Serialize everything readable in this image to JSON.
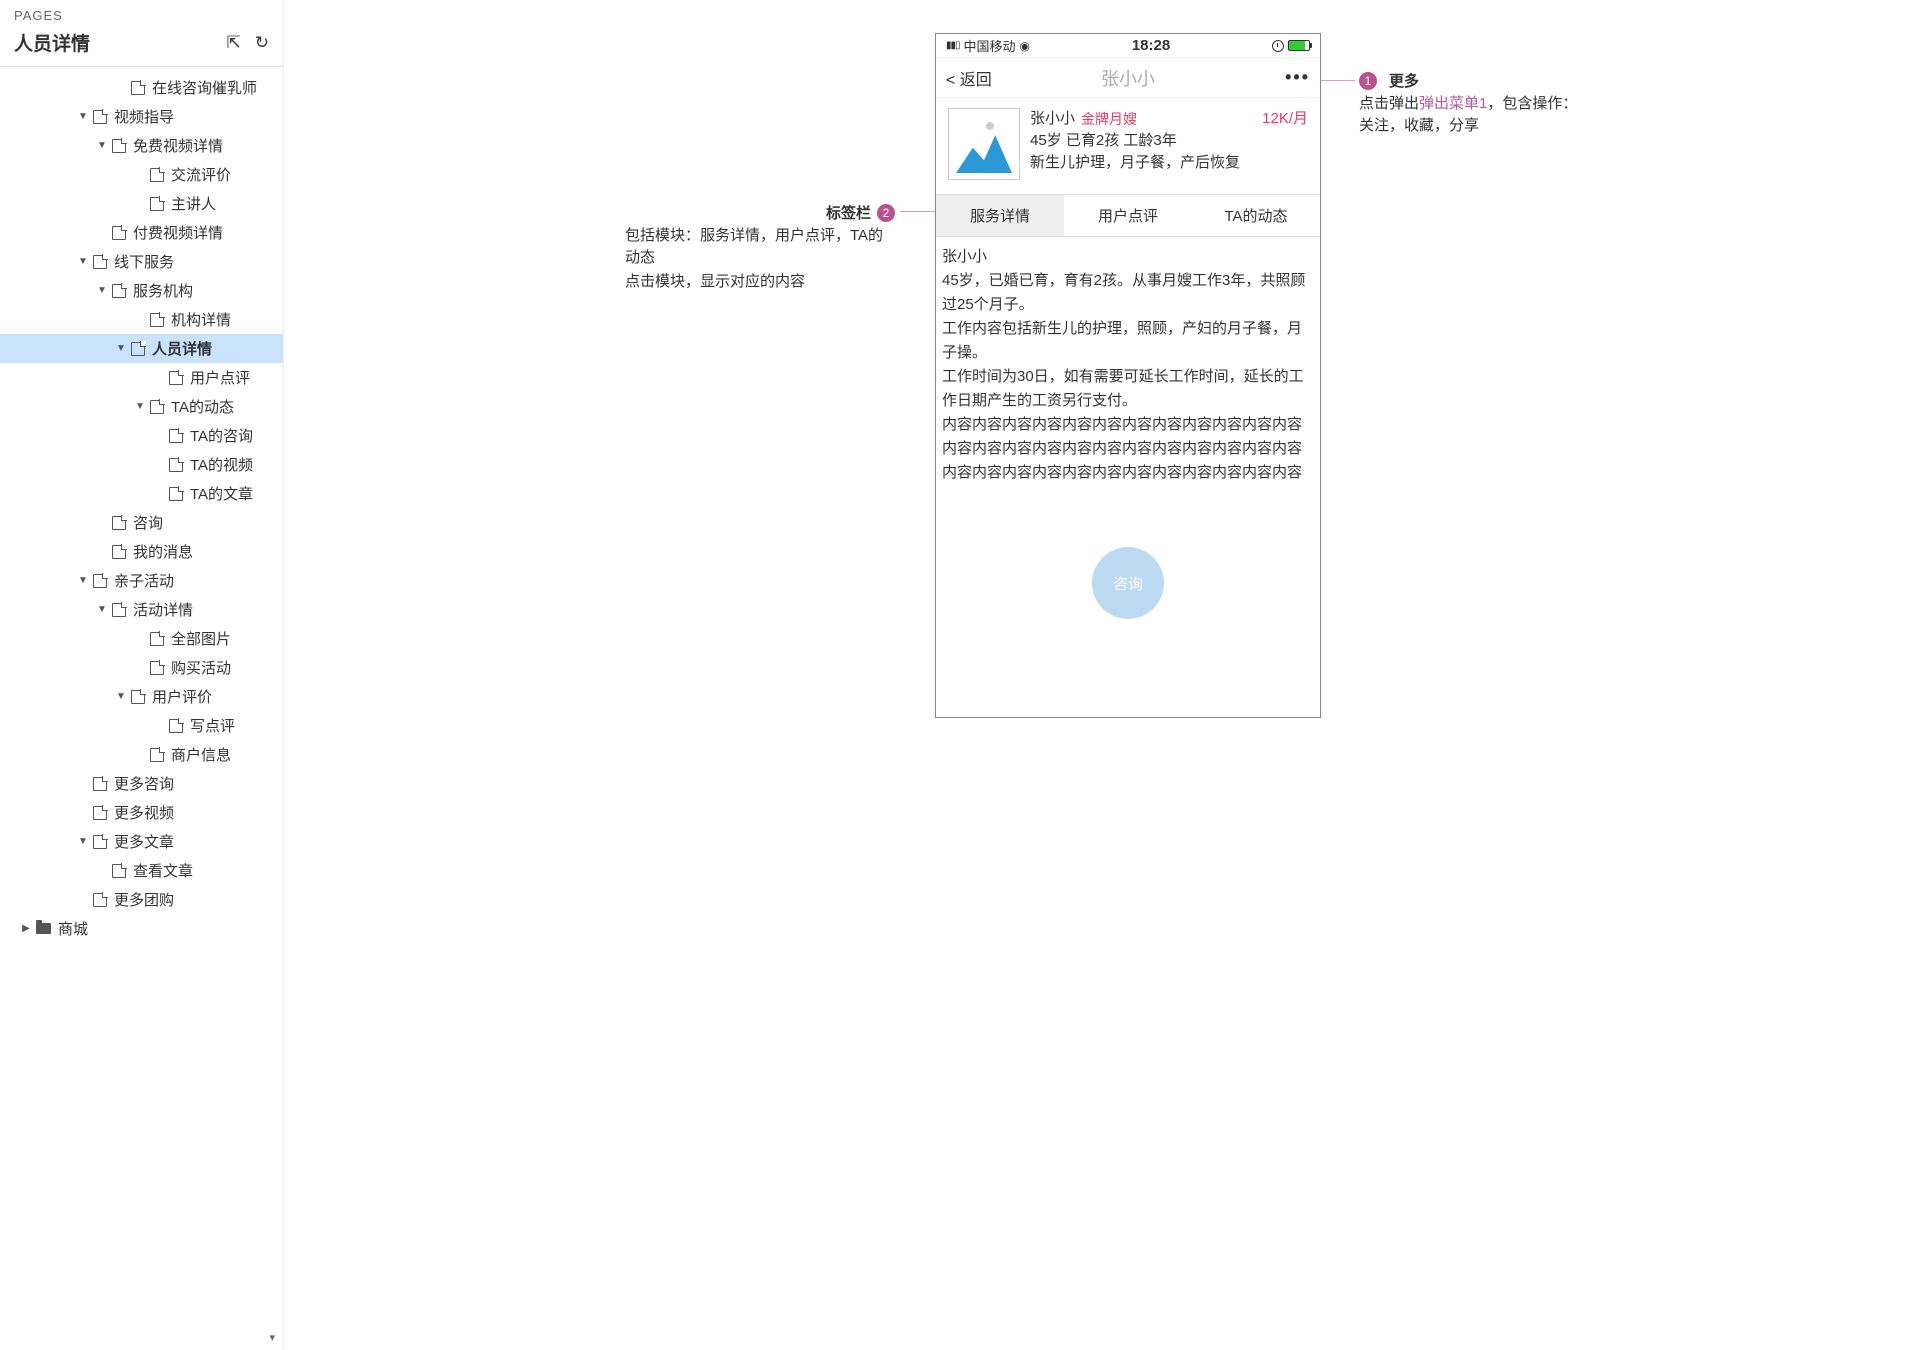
{
  "sidebar": {
    "section_label": "PAGES",
    "title": "人员详情",
    "items": [
      {
        "label": "在线咨询催乳师",
        "indent": 6,
        "caret": null
      },
      {
        "label": "视频指导",
        "indent": 4,
        "caret": "down"
      },
      {
        "label": "免费视频详情",
        "indent": 5,
        "caret": "down"
      },
      {
        "label": "交流评价",
        "indent": 7,
        "caret": null
      },
      {
        "label": "主讲人",
        "indent": 7,
        "caret": null
      },
      {
        "label": "付费视频详情",
        "indent": 5,
        "caret": null
      },
      {
        "label": "线下服务",
        "indent": 4,
        "caret": "down"
      },
      {
        "label": "服务机构",
        "indent": 5,
        "caret": "down"
      },
      {
        "label": "机构详情",
        "indent": 7,
        "caret": null
      },
      {
        "label": "人员详情",
        "indent": 6,
        "caret": "down",
        "active": true
      },
      {
        "label": "用户点评",
        "indent": 8,
        "caret": null
      },
      {
        "label": "TA的动态",
        "indent": 7,
        "caret": "down"
      },
      {
        "label": "TA的咨询",
        "indent": 8,
        "caret": null
      },
      {
        "label": "TA的视频",
        "indent": 8,
        "caret": null
      },
      {
        "label": "TA的文章",
        "indent": 8,
        "caret": null
      },
      {
        "label": "咨询",
        "indent": 5,
        "caret": null
      },
      {
        "label": "我的消息",
        "indent": 5,
        "caret": null
      },
      {
        "label": "亲子活动",
        "indent": 4,
        "caret": "down"
      },
      {
        "label": "活动详情",
        "indent": 5,
        "caret": "down"
      },
      {
        "label": "全部图片",
        "indent": 7,
        "caret": null
      },
      {
        "label": "购买活动",
        "indent": 7,
        "caret": null
      },
      {
        "label": "用户评价",
        "indent": 6,
        "caret": "down"
      },
      {
        "label": "写点评",
        "indent": 8,
        "caret": null
      },
      {
        "label": "商户信息",
        "indent": 7,
        "caret": null
      },
      {
        "label": "更多咨询",
        "indent": 4,
        "caret": null
      },
      {
        "label": "更多视频",
        "indent": 4,
        "caret": null
      },
      {
        "label": "更多文章",
        "indent": 4,
        "caret": "down"
      },
      {
        "label": "查看文章",
        "indent": 5,
        "caret": null
      },
      {
        "label": "更多团购",
        "indent": 4,
        "caret": null
      },
      {
        "label": "商城",
        "indent": 1,
        "caret": "right",
        "folder": true
      }
    ]
  },
  "mockup": {
    "status": {
      "carrier": "中国移动",
      "time": "18:28"
    },
    "nav": {
      "back": "返回",
      "title": "张小小",
      "more": "•••"
    },
    "profile": {
      "name": "张小小",
      "badge": "金牌月嫂",
      "price": "12K/月",
      "line2": "45岁  已育2孩   工龄3年",
      "line3": "新生儿护理，月子餐，产后恢复"
    },
    "tabs": [
      "服务详情",
      "用户点评",
      "TA的动态"
    ],
    "body_lines": [
      "张小小",
      "45岁，已婚已育，育有2孩。从事月嫂工作3年，共照顾过25个月子。",
      "工作内容包括新生儿的护理，照顾，产妇的月子餐，月子操。",
      "工作时间为30日，如有需要可延长工作时间，延长的工作日期产生的工资另行支付。",
      "内容内容内容内容内容内容内容内容内容内容内容内容内容内容内容内容内容内容内容内容内容内容内容内容内容内容内容内容内容内容内容内容内容内容内容内容"
    ],
    "consult": "咨询"
  },
  "annotations": {
    "a1": {
      "num": "1",
      "title": "更多",
      "desc_pre": "点击弹出",
      "desc_link": "弹出菜单1",
      "desc_post": "，包含操作：关注，收藏，分享"
    },
    "a2": {
      "num": "2",
      "title": "标签栏",
      "desc1": "包括模块：服务详情，用户点评，TA的动态",
      "desc2": "点击模块，显示对应的内容"
    }
  }
}
